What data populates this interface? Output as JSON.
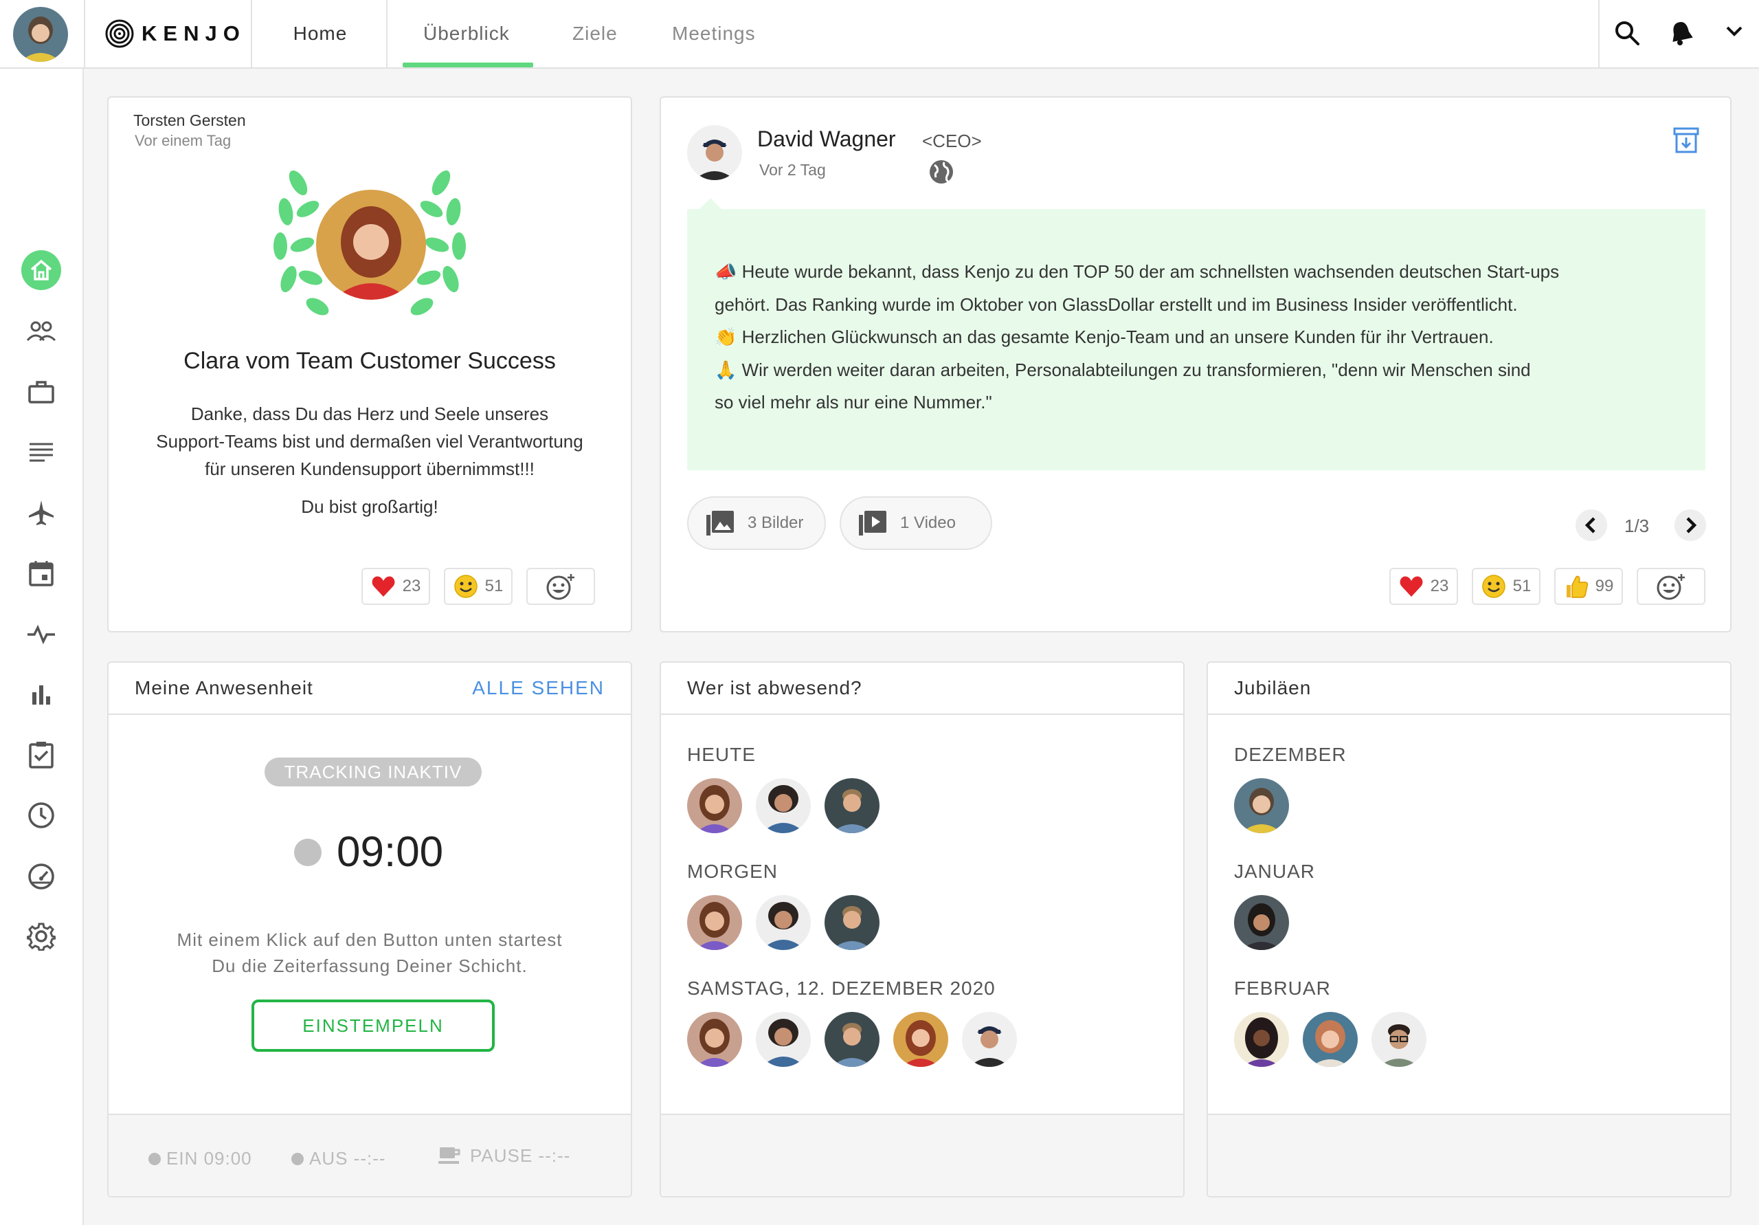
{
  "app": {
    "logo": "KENJO"
  },
  "nav": {
    "home": "Home",
    "overview": "Überblick",
    "goals": "Ziele",
    "meetings": "Meetings"
  },
  "sidebar": {
    "items": [
      "home-icon",
      "people-icon",
      "briefcase-icon",
      "list-icon",
      "airplane-icon",
      "calendar-icon",
      "pulse-icon",
      "bar-chart-icon",
      "checklist-icon",
      "clock-icon",
      "gauge-icon",
      "gear-icon"
    ]
  },
  "kudos": {
    "author": "Torsten Gersten",
    "time": "Vor einem Tag",
    "title": "Clara vom Team Customer Success",
    "body_lines": [
      "Danke, dass Du das Herz und Seele unseres",
      "Support-Teams bist und dermaßen viel Verantwortung",
      "für unseren Kundensupport übernimmst!!!"
    ],
    "closing": "Du bist großartig!",
    "reactions": [
      {
        "emoji": "heart",
        "count": "23"
      },
      {
        "emoji": "smile",
        "count": "51"
      }
    ]
  },
  "post": {
    "author": "David Wagner",
    "role": "<CEO>",
    "time": "Vor 2 Tag",
    "lines": [
      "📣 Heute wurde bekannt, dass Kenjo zu den TOP 50 der am schnellsten wachsenden deutschen Start-ups",
      "gehört. Das Ranking wurde im Oktober von GlassDollar erstellt und im Business Insider veröffentlicht.",
      "👏 Herzlichen Glückwunsch an das gesamte Kenjo-Team und an unsere Kunden für ihr Vertrauen.",
      "🙏 Wir werden weiter daran arbeiten, Personalabteilungen zu transformieren, \"denn wir Menschen sind",
      "so viel mehr als nur eine Nummer.\""
    ],
    "images_label": "3 Bilder",
    "video_label": "1 Video",
    "pager": "1/3",
    "reactions": [
      {
        "emoji": "heart",
        "count": "23"
      },
      {
        "emoji": "smile",
        "count": "51"
      },
      {
        "emoji": "thumbs-up",
        "count": "99"
      }
    ]
  },
  "attendance": {
    "title": "Meine Anwesenheit",
    "see_all": "ALLE SEHEN",
    "status": "TRACKING INAKTIV",
    "time": "09:00",
    "hint_1": "Mit einem Klick auf den Button unten startest",
    "hint_2": "Du die Zeiterfassung Deiner Schicht.",
    "button": "EINSTEMPELN",
    "footer": {
      "in": "EIN 09:00",
      "out": "AUS --:--",
      "pause": "PAUSE --:--"
    }
  },
  "absent": {
    "title": "Wer ist abwesend?",
    "groups": [
      {
        "label": "HEUTE"
      },
      {
        "label": "MORGEN"
      },
      {
        "label": "SAMSTAG, 12. DEZEMBER 2020"
      }
    ]
  },
  "jubilees": {
    "title": "Jubiläen",
    "groups": [
      {
        "label": "DEZEMBER"
      },
      {
        "label": "JANUAR"
      },
      {
        "label": "FEBRUAR"
      }
    ]
  },
  "colors": {
    "accent": "#5fd87f",
    "link": "#4a90e2",
    "button_green": "#22b545",
    "post_bg": "#e8fbea"
  }
}
